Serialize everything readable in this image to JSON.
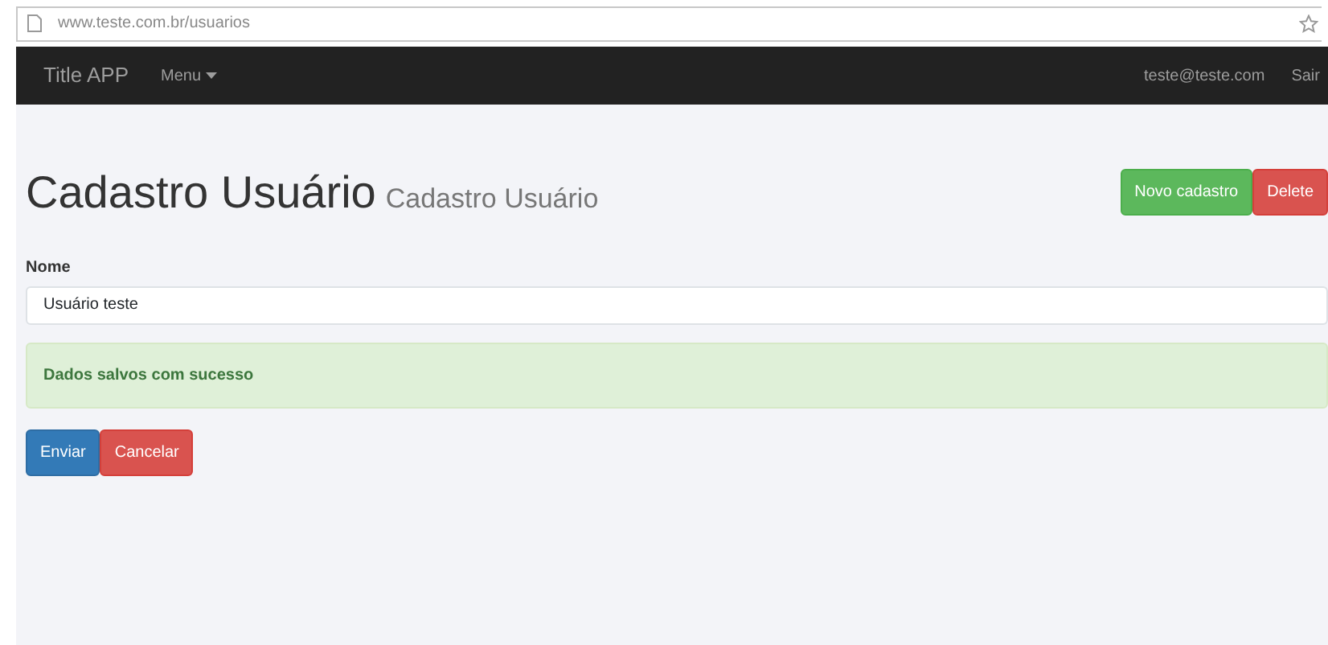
{
  "browser": {
    "url": "www.teste.com.br/usuarios"
  },
  "navbar": {
    "brand": "Title APP",
    "menu": "Menu",
    "user": "teste@teste.com",
    "logout": "Sair"
  },
  "header": {
    "title": "Cadastro Usuário",
    "subtitle": "Cadastro Usuário",
    "buttons": [
      {
        "label": "Novo cadastro",
        "kind": "success"
      },
      {
        "label": "Delete",
        "kind": "danger"
      }
    ]
  },
  "form": {
    "label": "Nome",
    "value": "Usuário teste"
  },
  "alert": {
    "text": "Dados salvos com sucesso",
    "kind": "success"
  },
  "actions": [
    {
      "label": "Enviar",
      "kind": "primary"
    },
    {
      "label": "Cancelar",
      "kind": "danger"
    }
  ]
}
